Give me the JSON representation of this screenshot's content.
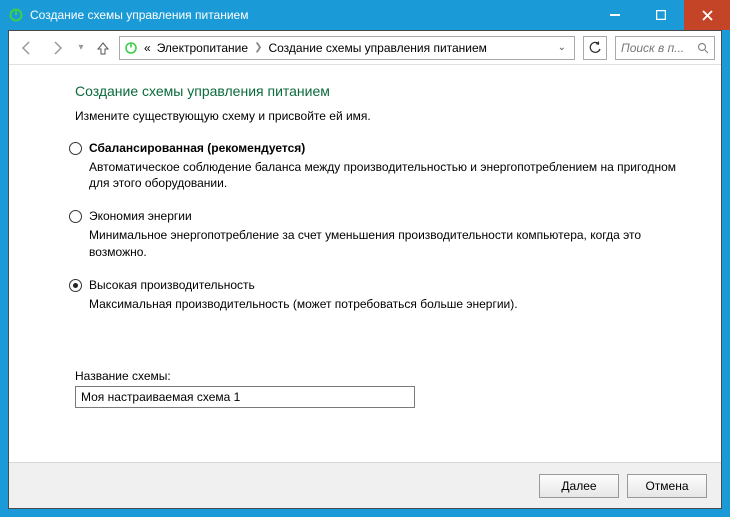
{
  "window": {
    "title": "Создание схемы управления питанием"
  },
  "breadcrumb": {
    "prefix": "«",
    "parent": "Электропитание",
    "current": "Создание схемы управления питанием"
  },
  "search": {
    "placeholder": "Поиск в п..."
  },
  "page": {
    "heading": "Создание схемы управления питанием",
    "subheading": "Измените существующую схему и присвойте ей имя."
  },
  "options": [
    {
      "title": "Сбалансированная (рекомендуется)",
      "desc": "Автоматическое соблюдение баланса между производительностью и энергопотреблением на пригодном для этого оборудовании.",
      "bold": true,
      "selected": false
    },
    {
      "title": "Экономия энергии",
      "desc": "Минимальное энергопотребление за счет уменьшения производительности компьютера, когда это возможно.",
      "bold": false,
      "selected": false
    },
    {
      "title": "Высокая производительность",
      "desc": "Максимальная производительность (может потребоваться больше энергии).",
      "bold": false,
      "selected": true
    }
  ],
  "name_field": {
    "label": "Название схемы:",
    "value": "Моя настраиваемая схема 1"
  },
  "buttons": {
    "next": "Далее",
    "cancel": "Отмена"
  }
}
